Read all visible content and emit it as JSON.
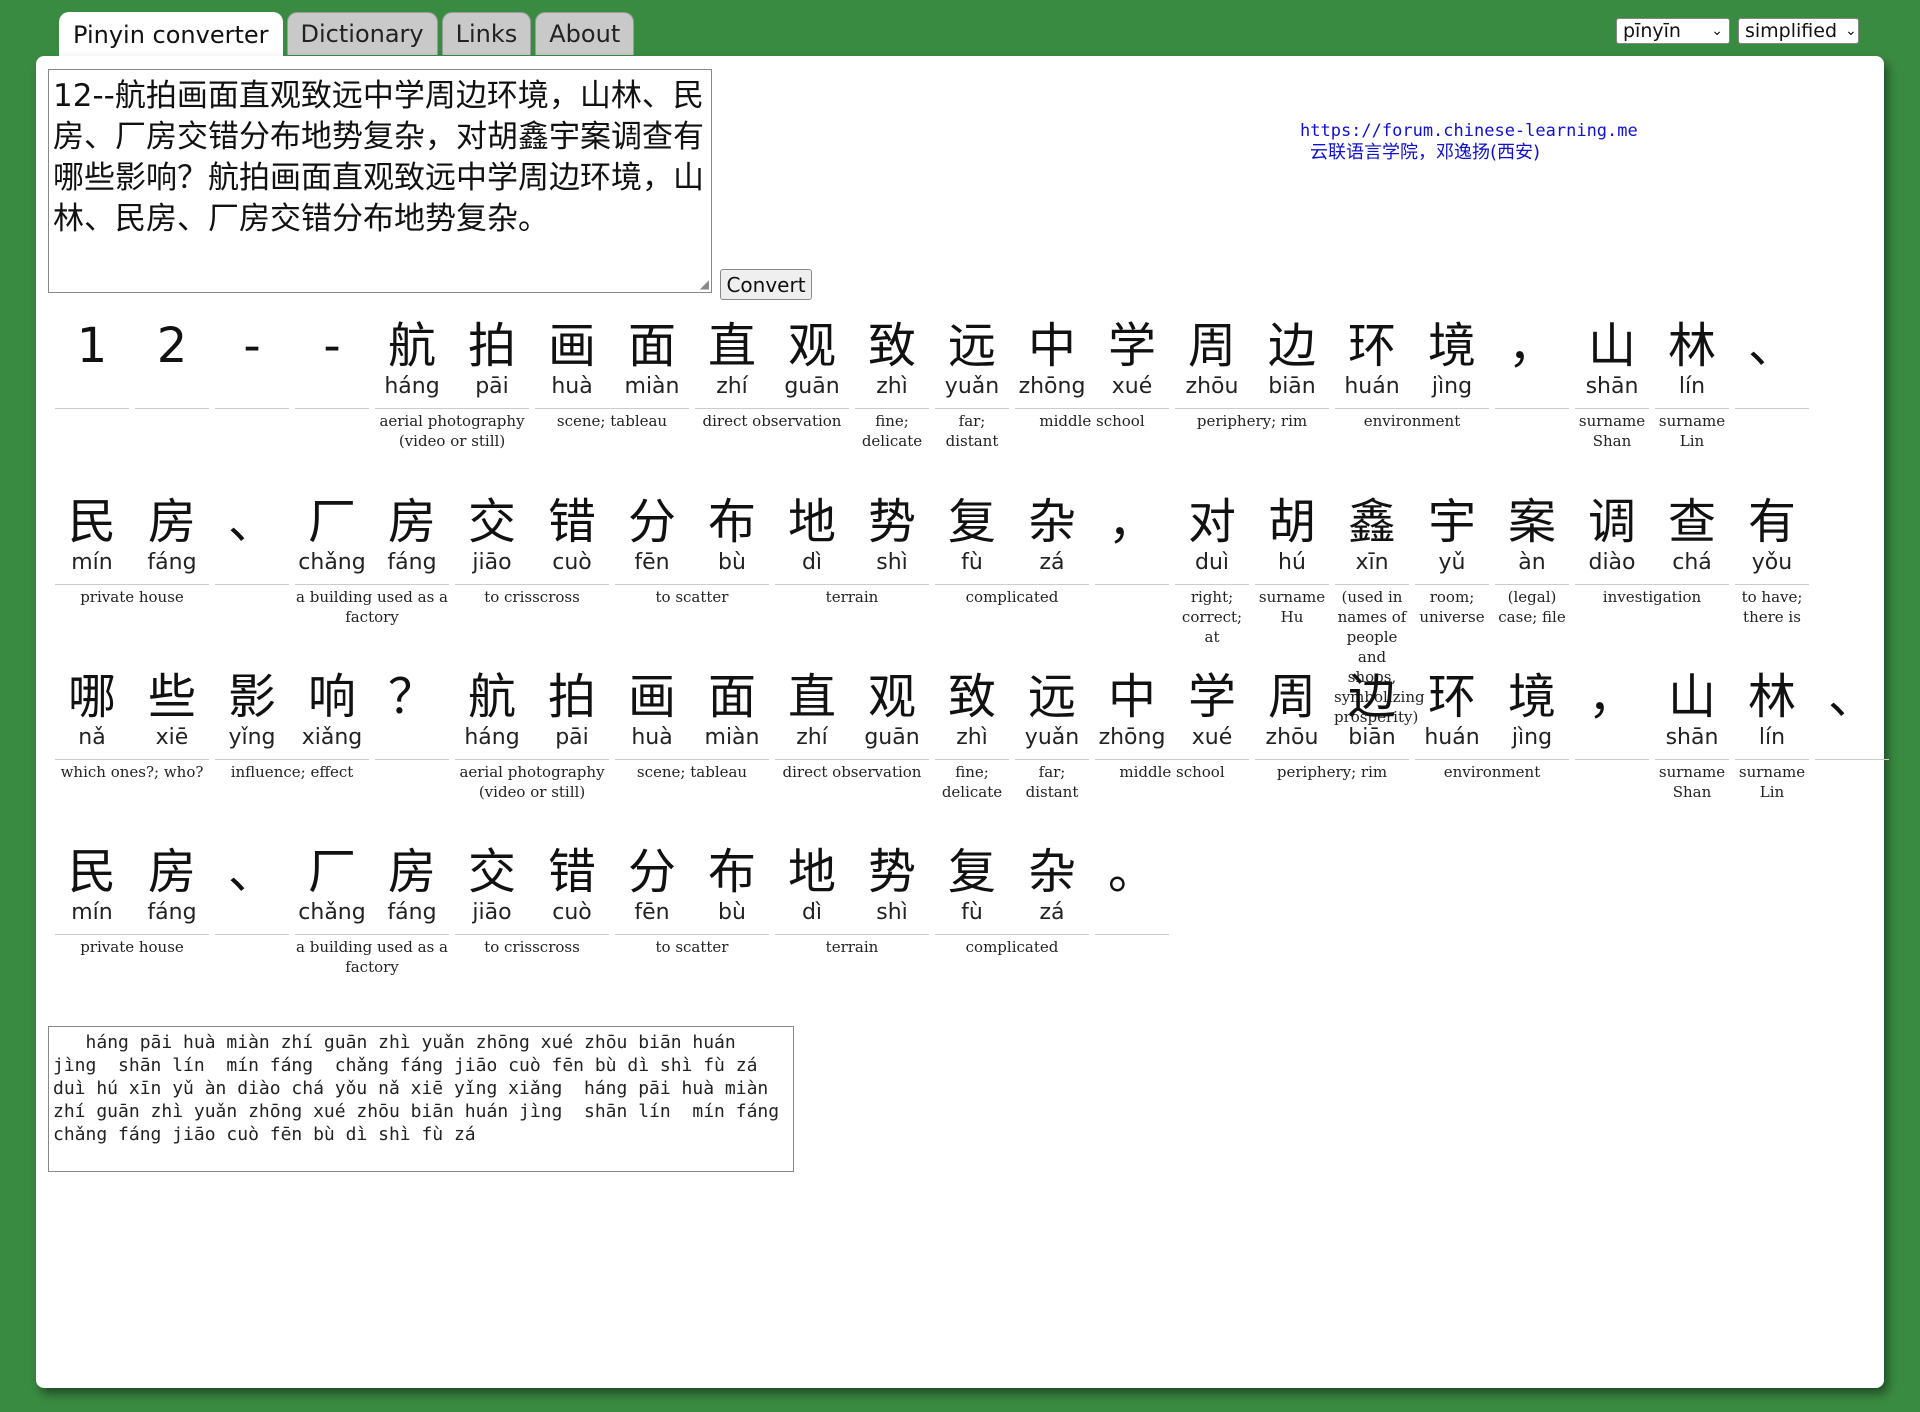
{
  "tabs": [
    "Pinyin converter",
    "Dictionary",
    "Links",
    "About"
  ],
  "selects": {
    "romanization": "pīnyīn",
    "script": "simplified"
  },
  "input_text": "12--航拍画面直观致远中学周边环境，山林、民房、厂房交错分布地势复杂，对胡鑫宇案调查有哪些影响？航拍画面直观致远中学周边环境，山林、民房、厂房交错分布地势复杂。",
  "convert_label": "Convert",
  "credit": {
    "url": "https://forum.chinese-learning.me",
    "org": "云联语言学院，邓逸扬(西安)"
  },
  "rows": [
    [
      {
        "c": [
          "1"
        ],
        "p": [
          ""
        ],
        "d": ""
      },
      {
        "c": [
          "2"
        ],
        "p": [
          ""
        ],
        "d": ""
      },
      {
        "c": [
          "-"
        ],
        "p": [
          ""
        ],
        "d": ""
      },
      {
        "c": [
          "-"
        ],
        "p": [
          ""
        ],
        "d": ""
      },
      {
        "c": [
          "航",
          "拍"
        ],
        "p": [
          "háng",
          "pāi"
        ],
        "d": "aerial photography (video or still)"
      },
      {
        "c": [
          "画",
          "面"
        ],
        "p": [
          "huà",
          "miàn"
        ],
        "d": "scene; tableau"
      },
      {
        "c": [
          "直",
          "观"
        ],
        "p": [
          "zhí",
          "guān"
        ],
        "d": "direct observation"
      },
      {
        "c": [
          "致"
        ],
        "p": [
          "zhì"
        ],
        "d": "fine; delicate"
      },
      {
        "c": [
          "远"
        ],
        "p": [
          "yuǎn"
        ],
        "d": "far; distant"
      },
      {
        "c": [
          "中",
          "学"
        ],
        "p": [
          "zhōng",
          "xué"
        ],
        "d": "middle school"
      },
      {
        "c": [
          "周",
          "边"
        ],
        "p": [
          "zhōu",
          "biān"
        ],
        "d": "periphery; rim"
      },
      {
        "c": [
          "环",
          "境"
        ],
        "p": [
          "huán",
          "jìng"
        ],
        "d": "environment"
      },
      {
        "c": [
          "，"
        ],
        "p": [
          ""
        ],
        "d": ""
      },
      {
        "c": [
          "山"
        ],
        "p": [
          "shān"
        ],
        "d": "surname Shan"
      },
      {
        "c": [
          "林"
        ],
        "p": [
          "lín"
        ],
        "d": "surname Lin"
      },
      {
        "c": [
          "、"
        ],
        "p": [
          ""
        ],
        "d": ""
      }
    ],
    [
      {
        "c": [
          "民",
          "房"
        ],
        "p": [
          "mín",
          "fáng"
        ],
        "d": "private house"
      },
      {
        "c": [
          "、"
        ],
        "p": [
          ""
        ],
        "d": ""
      },
      {
        "c": [
          "厂",
          "房"
        ],
        "p": [
          "chǎng",
          "fáng"
        ],
        "d": "a building used as a factory"
      },
      {
        "c": [
          "交",
          "错"
        ],
        "p": [
          "jiāo",
          "cuò"
        ],
        "d": "to crisscross"
      },
      {
        "c": [
          "分",
          "布"
        ],
        "p": [
          "fēn",
          "bù"
        ],
        "d": "to scatter"
      },
      {
        "c": [
          "地",
          "势"
        ],
        "p": [
          "dì",
          "shì"
        ],
        "d": "terrain"
      },
      {
        "c": [
          "复",
          "杂"
        ],
        "p": [
          "fù",
          "zá"
        ],
        "d": "complicated"
      },
      {
        "c": [
          "，"
        ],
        "p": [
          ""
        ],
        "d": ""
      },
      {
        "c": [
          "对"
        ],
        "p": [
          "duì"
        ],
        "d": "right; correct; at"
      },
      {
        "c": [
          "胡"
        ],
        "p": [
          "hú"
        ],
        "d": "surname Hu"
      },
      {
        "c": [
          "鑫"
        ],
        "p": [
          "xīn"
        ],
        "d": "(used in names of people and shops, symbolizing prosperity)"
      },
      {
        "c": [
          "宇"
        ],
        "p": [
          "yǔ"
        ],
        "d": "room; universe"
      },
      {
        "c": [
          "案"
        ],
        "p": [
          "àn"
        ],
        "d": "(legal) case; file"
      },
      {
        "c": [
          "调",
          "查"
        ],
        "p": [
          "diào",
          "chá"
        ],
        "d": "investigation"
      },
      {
        "c": [
          "有"
        ],
        "p": [
          "yǒu"
        ],
        "d": "to have; there is"
      }
    ],
    [
      {
        "c": [
          "哪",
          "些"
        ],
        "p": [
          "nǎ",
          "xiē"
        ],
        "d": "which ones?; who?"
      },
      {
        "c": [
          "影",
          "响"
        ],
        "p": [
          "yǐng",
          "xiǎng"
        ],
        "d": "influence; effect"
      },
      {
        "c": [
          "？"
        ],
        "p": [
          ""
        ],
        "d": ""
      },
      {
        "c": [
          "航",
          "拍"
        ],
        "p": [
          "háng",
          "pāi"
        ],
        "d": "aerial photography (video or still)"
      },
      {
        "c": [
          "画",
          "面"
        ],
        "p": [
          "huà",
          "miàn"
        ],
        "d": "scene; tableau"
      },
      {
        "c": [
          "直",
          "观"
        ],
        "p": [
          "zhí",
          "guān"
        ],
        "d": "direct observation"
      },
      {
        "c": [
          "致"
        ],
        "p": [
          "zhì"
        ],
        "d": "fine; delicate"
      },
      {
        "c": [
          "远"
        ],
        "p": [
          "yuǎn"
        ],
        "d": "far; distant"
      },
      {
        "c": [
          "中",
          "学"
        ],
        "p": [
          "zhōng",
          "xué"
        ],
        "d": "middle school"
      },
      {
        "c": [
          "周",
          "边"
        ],
        "p": [
          "zhōu",
          "biān"
        ],
        "d": "periphery; rim"
      },
      {
        "c": [
          "环",
          "境"
        ],
        "p": [
          "huán",
          "jìng"
        ],
        "d": "environment"
      },
      {
        "c": [
          "，"
        ],
        "p": [
          ""
        ],
        "d": ""
      },
      {
        "c": [
          "山"
        ],
        "p": [
          "shān"
        ],
        "d": "surname Shan"
      },
      {
        "c": [
          "林"
        ],
        "p": [
          "lín"
        ],
        "d": "surname Lin"
      },
      {
        "c": [
          "、"
        ],
        "p": [
          ""
        ],
        "d": ""
      }
    ],
    [
      {
        "c": [
          "民",
          "房"
        ],
        "p": [
          "mín",
          "fáng"
        ],
        "d": "private house"
      },
      {
        "c": [
          "、"
        ],
        "p": [
          ""
        ],
        "d": ""
      },
      {
        "c": [
          "厂",
          "房"
        ],
        "p": [
          "chǎng",
          "fáng"
        ],
        "d": "a building used as a factory"
      },
      {
        "c": [
          "交",
          "错"
        ],
        "p": [
          "jiāo",
          "cuò"
        ],
        "d": "to crisscross"
      },
      {
        "c": [
          "分",
          "布"
        ],
        "p": [
          "fēn",
          "bù"
        ],
        "d": "to scatter"
      },
      {
        "c": [
          "地",
          "势"
        ],
        "p": [
          "dì",
          "shì"
        ],
        "d": "terrain"
      },
      {
        "c": [
          "复",
          "杂"
        ],
        "p": [
          "fù",
          "zá"
        ],
        "d": "complicated"
      },
      {
        "c": [
          "。"
        ],
        "p": [
          ""
        ],
        "d": ""
      }
    ]
  ],
  "output_text": "   háng pāi huà miàn zhí guān zhì yuǎn zhōng xué zhōu biān huán jìng  shān lín  mín fáng  chǎng fáng jiāo cuò fēn bù dì shì fù zá  duì hú xīn yǔ àn diào chá yǒu nǎ xiē yǐng xiǎng  háng pāi huà miàn zhí guān zhì yuǎn zhōng xué zhōu biān huán jìng  shān lín  mín fáng  chǎng fáng jiāo cuò fēn bù dì shì fù zá"
}
